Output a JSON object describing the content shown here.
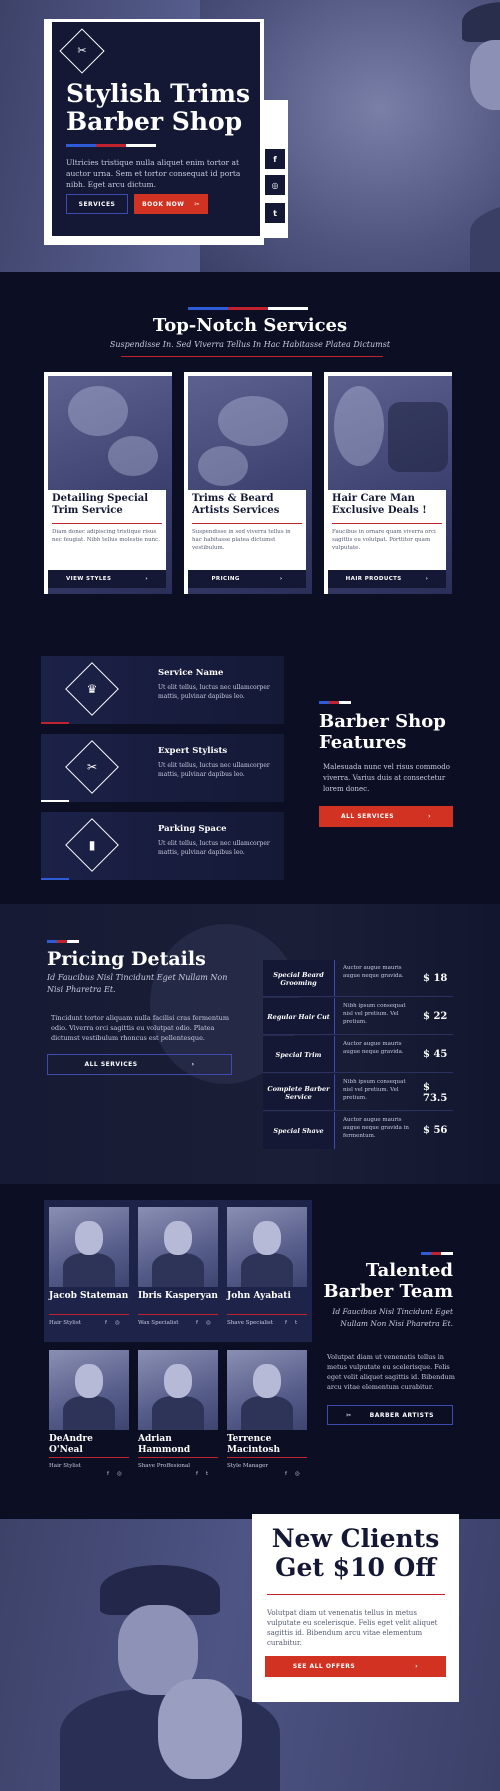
{
  "hero": {
    "title": "Stylish Trims Barber Shop",
    "text": "Ultricies tristique nulla aliquet enim tortor at auctor urna. Sem et tortor consequat id porta nibh. Eget arcu dictum.",
    "services_button": "SERVICES",
    "book_button": "BOOK NOW",
    "social": [
      "f",
      "◎",
      "t"
    ]
  },
  "services": {
    "title": "Top-Notch Services",
    "subtitle": "Suspendisse In. Sed Viverra Tellus In Hac Habitasse Platea Dictumst",
    "cards": [
      {
        "title": "Detailing Special Trim Service",
        "text": "Diam donec adipiscing tristique risus nec feugiat. Nibh tellus molestie nunc.",
        "button": "VIEW STYLES"
      },
      {
        "title": "Trims & Beard Artists Services",
        "text": "Suspendisse in sed viverra tellus in hac habitasse platea dictumst vestibulum.",
        "button": "PRICING"
      },
      {
        "title": "Hair Care Man Exclusive Deals !",
        "text": "Faucibus in ornare quam viverra orci sagittis eu volutpat. Porttitor quam vulputate.",
        "button": "HAIR PRODUCTS"
      }
    ]
  },
  "features": {
    "items": [
      {
        "title": "Service Name",
        "text": "Ut elit tellus, luctus nec ullamcorper mattis, pulvinar dapibus leo.",
        "icon": "chair-icon"
      },
      {
        "title": "Expert Stylists",
        "text": "Ut elit tellus, luctus nec ullamcorper mattis, pulvinar dapibus leo.",
        "icon": "scissors-icon"
      },
      {
        "title": "Parking Space",
        "text": "Ut elit tellus, luctus nec ullamcorper mattis, pulvinar dapibus leo.",
        "icon": "barber-pole-icon"
      }
    ],
    "heading": "Barber Shop Features",
    "text": "Malesuada nunc vel risus commodo viverra. Varius duis at consectetur lorem donec.",
    "button": "ALL SERVICES"
  },
  "pricing": {
    "title": "Pricing Details",
    "subtitle": "Id Faucibus Nisl Tincidunt Eget Nullam Non Nisi Pharetra Et.",
    "text": "Tincidunt tortor aliquam nulla facilisi cras fermentum odio. Viverra orci sagittis eu volutpat odio. Platea dictumst vestibulum rhoncus est pellentesque.",
    "button": "ALL SERVICES",
    "rows": [
      {
        "name": "Special Beard Grooming",
        "desc": "Auctor augue mauris augue neque gravida.",
        "price": "$ 18"
      },
      {
        "name": "Regular Hair Cut",
        "desc": "Nibh ipsum consequat nisl vel pretium. Vel pretium.",
        "price": "$ 22"
      },
      {
        "name": "Special Trim",
        "desc": "Auctor augue mauris augue neque gravida.",
        "price": "$ 45"
      },
      {
        "name": "Complete Barber Service",
        "desc": "Nibh ipsum consequat nisl vel pretium. Vel pretium.",
        "price": "$ 73.5"
      },
      {
        "name": "Special Shave",
        "desc": "Auctor augue mauris augue neque gravida in fermentum.",
        "price": "$ 56"
      }
    ]
  },
  "team": {
    "members": [
      {
        "name": "Jacob Stateman",
        "role": "Hair Stylist"
      },
      {
        "name": "Ibris Kasperyan",
        "role": "Wax Specialist"
      },
      {
        "name": "John Ayabati",
        "role": "Shave Specialist"
      },
      {
        "name": "DeAndre O'Neal",
        "role": "Hair Stylist"
      },
      {
        "name": "Adrian Hammond",
        "role": "Shave Proffesional"
      },
      {
        "name": "Terrence Macintosh",
        "role": "Style Manager"
      }
    ],
    "heading": "Talented Barber Team",
    "subtitle": "Id Faucibus Nisl Tincidunt Eget Nullam Non Nisi Pharetra Et.",
    "text": "Volutpat diam ut venenatis tellus in metus vulputate eu scelerisque. Felis eget velit aliquet sagittis id. Bibendum arcu vitae elementum curabitur.",
    "button": "BARBER ARTISTS"
  },
  "offer": {
    "title": "New Clients Get $10 Off",
    "text": "Volutpat diam ut venenatis tellus in metus vulputate eu scelerisque. Felis eget velit aliquet sagittis id. Bibendum arcu vitae elementum curabitur.",
    "button": "SEE ALL OFFERS"
  },
  "colors": {
    "navy": "#0c0f24",
    "card": "#141834",
    "red": "#d23222",
    "blue": "#2e5bd6"
  }
}
